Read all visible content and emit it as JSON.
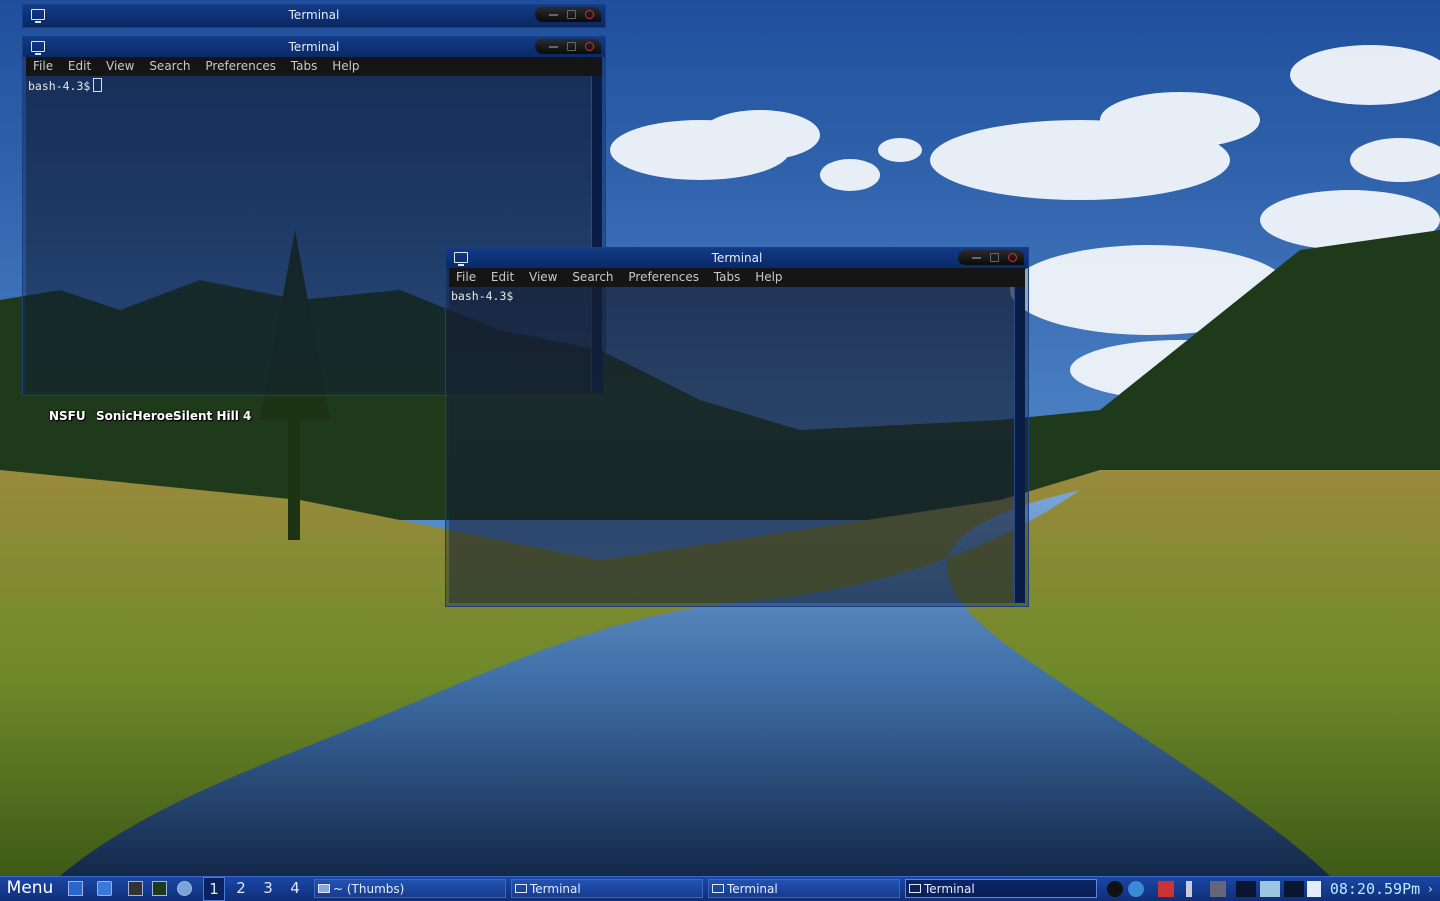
{
  "desktop": {
    "icons": [
      {
        "label": "NSFU"
      },
      {
        "label": "SonicHeroes"
      },
      {
        "label": "Silent Hill 4"
      }
    ]
  },
  "windows": [
    {
      "title": "Terminal",
      "menu": [
        "File",
        "Edit",
        "View",
        "Search",
        "Preferences",
        "Tabs",
        "Help"
      ],
      "prompt": "bash-4.3$"
    },
    {
      "title": "Terminal",
      "menu": [
        "File",
        "Edit",
        "View",
        "Search",
        "Preferences",
        "Tabs",
        "Help"
      ],
      "prompt": "bash-4.3$"
    },
    {
      "title": "Terminal",
      "menu": [
        "File",
        "Edit",
        "View",
        "Search",
        "Preferences",
        "Tabs",
        "Help"
      ],
      "prompt": "bash-4.3$"
    }
  ],
  "taskbar": {
    "menu_label": "Menu",
    "workspaces": [
      "1",
      "2",
      "3",
      "4"
    ],
    "active_workspace": "1",
    "tasks": [
      {
        "label": "~ (Thumbs)",
        "icon": "folder-icon"
      },
      {
        "label": "Terminal",
        "icon": "terminal-icon"
      },
      {
        "label": "Terminal",
        "icon": "terminal-icon"
      },
      {
        "label": "Terminal",
        "icon": "terminal-icon"
      }
    ],
    "clock": "08:20.59Pm"
  },
  "colors": {
    "taskbar": "#1b47a4",
    "titlebar": "#123a86",
    "clock_text": "#b9ecff"
  }
}
